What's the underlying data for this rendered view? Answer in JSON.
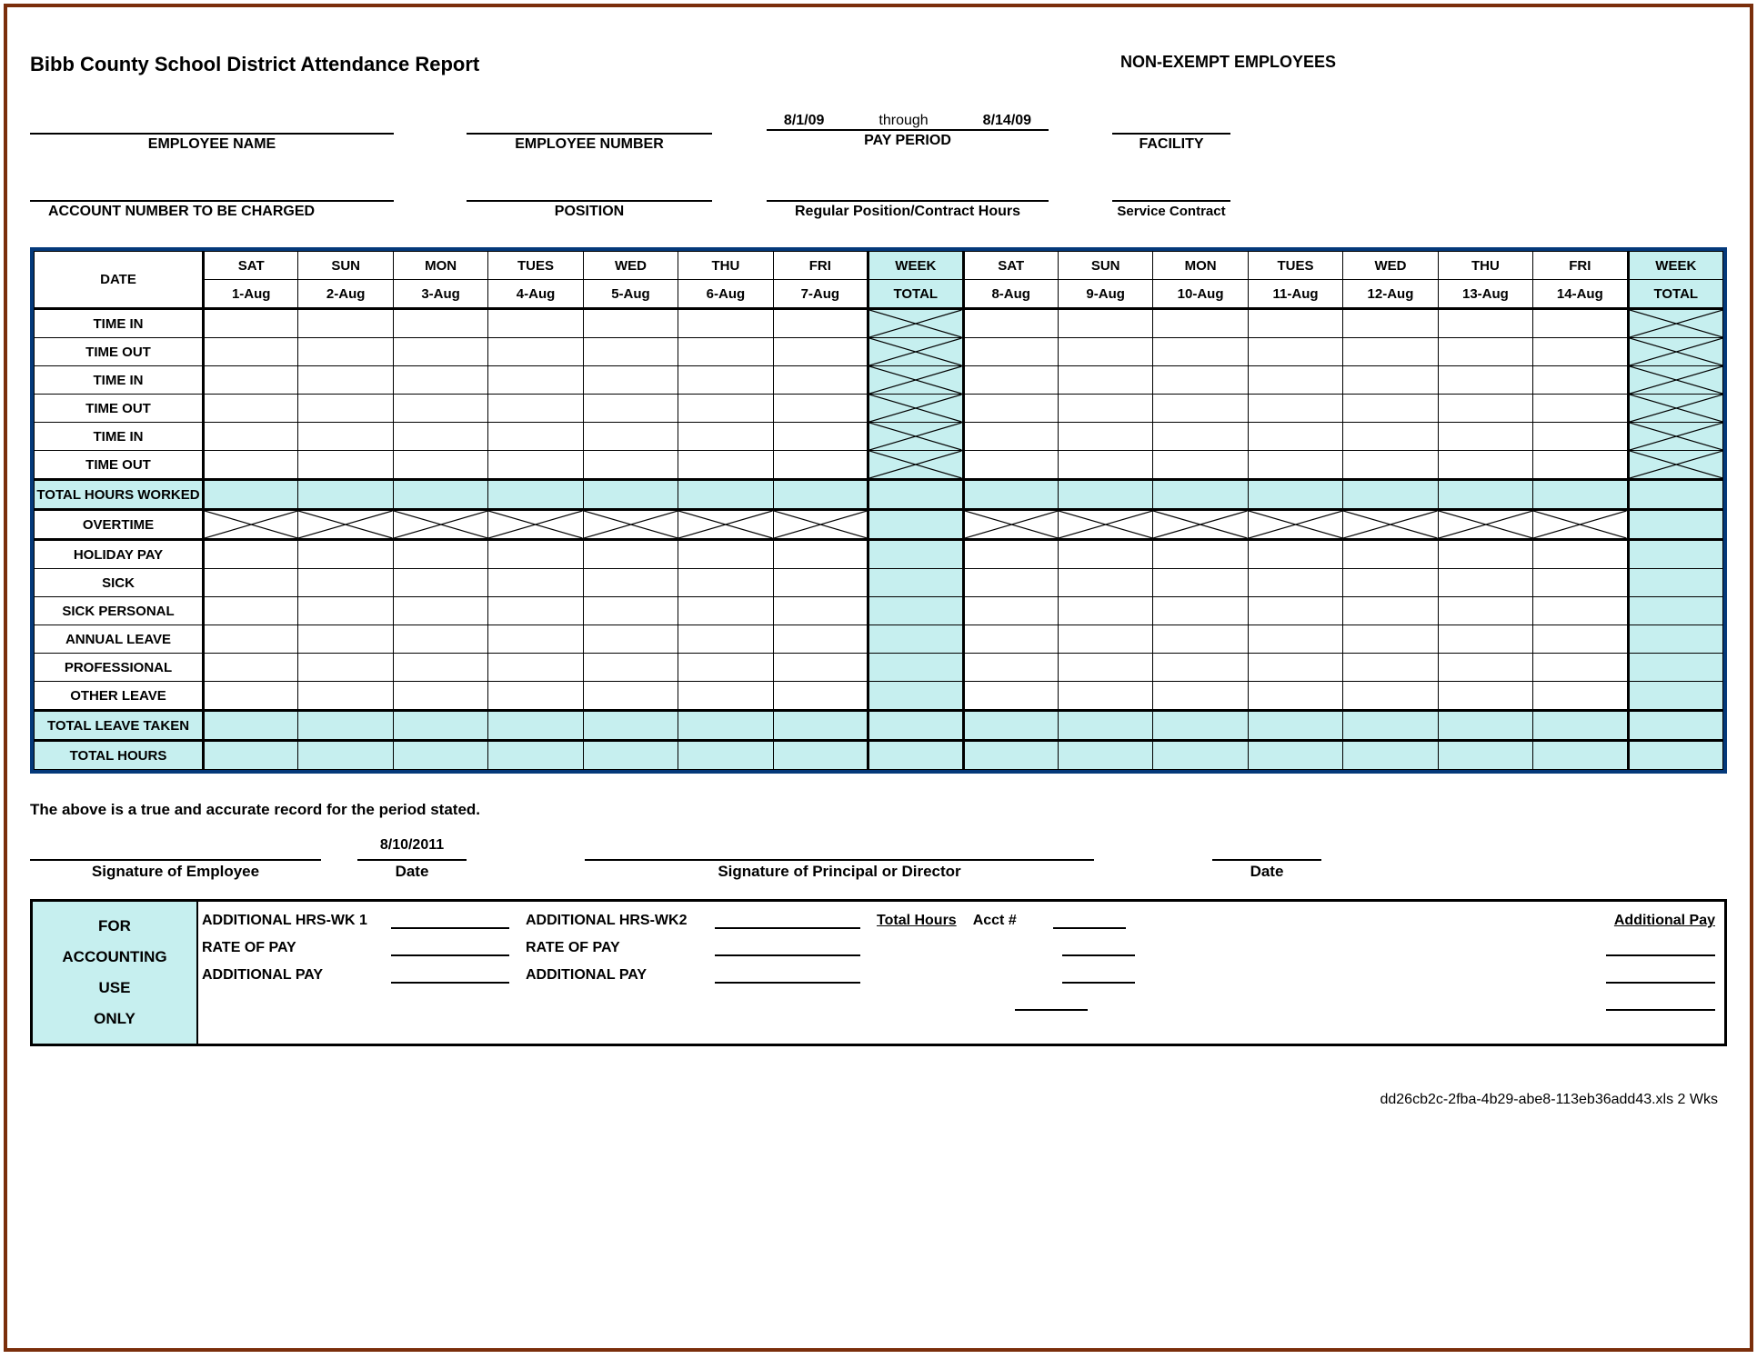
{
  "header": {
    "title": "Bibb County School District Attendance Report",
    "subtitle": "NON-EXEMPT EMPLOYEES"
  },
  "fields_row1": {
    "employee_name_label": "EMPLOYEE NAME",
    "employee_number_label": "EMPLOYEE NUMBER",
    "pay_period_start": "8/1/09",
    "pay_period_through": "through",
    "pay_period_end": "8/14/09",
    "pay_period_label": "PAY PERIOD",
    "facility_label": "FACILITY"
  },
  "fields_row2": {
    "account_label": "ACCOUNT NUMBER TO BE CHARGED",
    "position_label": "POSITION",
    "reg_hours_label": "Regular Position/Contract Hours",
    "service_contract_label": "Service Contract"
  },
  "grid": {
    "corner_label": "DATE",
    "days": [
      "SAT",
      "SUN",
      "MON",
      "TUES",
      "WED",
      "THU",
      "FRI",
      "WEEK",
      "SAT",
      "SUN",
      "MON",
      "TUES",
      "WED",
      "THU",
      "FRI",
      "WEEK"
    ],
    "dates": [
      "1-Aug",
      "2-Aug",
      "3-Aug",
      "4-Aug",
      "5-Aug",
      "6-Aug",
      "7-Aug",
      "TOTAL",
      "8-Aug",
      "9-Aug",
      "10-Aug",
      "11-Aug",
      "12-Aug",
      "13-Aug",
      "14-Aug",
      "TOTAL"
    ],
    "rows": [
      "TIME IN",
      "TIME OUT",
      "TIME IN",
      "TIME OUT",
      "TIME IN",
      "TIME OUT",
      "TOTAL HOURS WORKED",
      "OVERTIME",
      "HOLIDAY PAY",
      "SICK",
      "SICK PERSONAL",
      "ANNUAL LEAVE",
      "PROFESSIONAL",
      "OTHER LEAVE",
      "TOTAL LEAVE TAKEN",
      "TOTAL HOURS"
    ]
  },
  "disclaimer": "The above is a true and accurate record for the period stated.",
  "signatures": {
    "emp_sig_label": "Signature of Employee",
    "emp_date": "8/10/2011",
    "emp_date_label": "Date",
    "dir_sig_label": "Signature of Principal or Director",
    "dir_date_label": "Date"
  },
  "accounting": {
    "box_label_1": "FOR",
    "box_label_2": "ACCOUNTING",
    "box_label_3": "USE",
    "box_label_4": "ONLY",
    "add_hrs_wk1": "ADDITIONAL HRS-WK 1",
    "rate_of_pay": "RATE OF PAY",
    "additional_pay": "ADDITIONAL PAY",
    "add_hrs_wk2": "ADDITIONAL HRS-WK2",
    "total_hours": "Total Hours",
    "acct_num": "Acct #",
    "additional_pay_r": "Additional Pay"
  },
  "footer_filename": "dd26cb2c-2fba-4b29-abe8-113eb36add43.xls 2 Wks"
}
